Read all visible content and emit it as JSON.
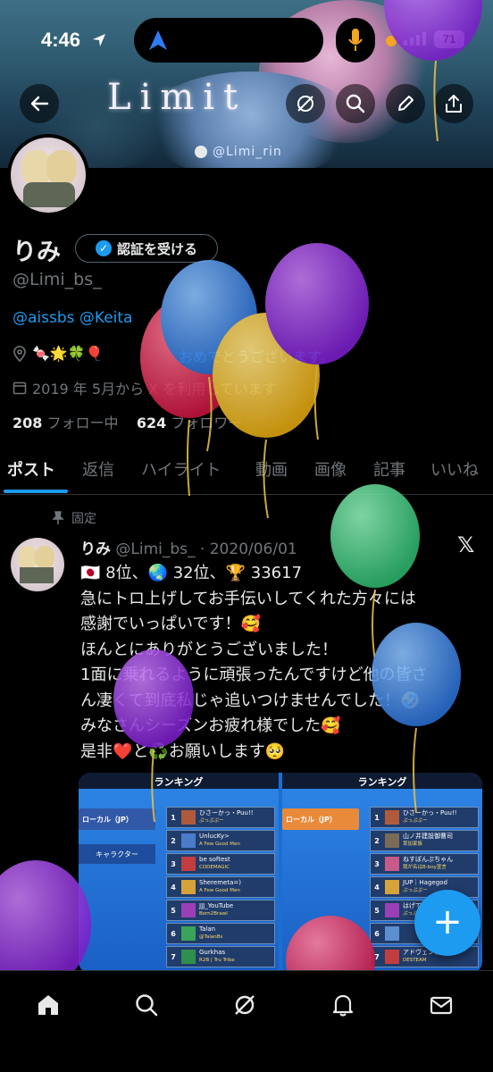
{
  "status_bar": {
    "time": "4:46",
    "battery": "71"
  },
  "banner": {
    "title": "Limit",
    "handle": "@Limi_rin"
  },
  "profile": {
    "name": "りみ",
    "verify_button": "認証を受ける",
    "handle": "@Limi_bs_",
    "bio": "@aissbs @Keita",
    "location": "🍬🌟🍀🎈",
    "birthday_text": "おめでとうございます。",
    "joined": "2019 年 5月から X を利用しています",
    "following_count": "208",
    "following_label": "フォロー中",
    "followers_count": "624",
    "followers_label": "フォロワー"
  },
  "tabs": [
    "ポスト",
    "返信",
    "ハイライト",
    "動画",
    "画像",
    "記事",
    "いいね"
  ],
  "post": {
    "pinned_label": "固定",
    "author": "りみ",
    "meta": "@Limi_bs_ · 2020/06/01",
    "lines": [
      "🇯🇵 8位、🌏 32位、🏆 33617",
      "急にトロ上げしてお手伝いしてくれた方々には",
      "感謝でいっぱいです！🥰",
      "ほんとにありがとうございました！",
      "1面に乗れるように頑張ったんですけど他の皆さ",
      "ん凄くて到底私じゃ追いつけませんでした！🤣",
      "みなさんシーズンお疲れ様でした🥰",
      "是非❤️と♻️お願いします🥺"
    ],
    "media": {
      "left": {
        "title": "ランキング",
        "local_label": "ローカル（JP）",
        "character_label": "キャラクター",
        "rows": [
          {
            "rank": "1",
            "name": "ひさーかっ・Puu!!",
            "sub": "ぷっぷぷー"
          },
          {
            "rank": "2",
            "name": "UnlucKy>",
            "sub": "A Few Good Men"
          },
          {
            "rank": "3",
            "name": "be softest",
            "sub": "CODEMAGIC"
          },
          {
            "rank": "4",
            "name": "Sheremeta=)",
            "sub": "A Few Good Men"
          },
          {
            "rank": "5",
            "name": "JJJ_YouTube",
            "sub": "Born2Brawl"
          },
          {
            "rank": "6",
            "name": "Talan",
            "sub": "@TalanBs"
          },
          {
            "rank": "7",
            "name": "Gurkhas",
            "sub": "R2B | Tru Tribe"
          }
        ]
      },
      "right": {
        "title": "ランキング",
        "local_label": "ローカル（JP）",
        "rows": [
          {
            "rank": "1",
            "name": "ひさーかっ・Puu!!",
            "sub": "ぷっぷぷー"
          },
          {
            "rank": "2",
            "name": "山ノ井建設御曹司",
            "sub": "草加家族"
          },
          {
            "rank": "3",
            "name": "ねすぽんぷちゃん",
            "sub": "我が名はB-boy宣言"
          },
          {
            "rank": "4",
            "name": "JUP｜Hagegod",
            "sub": "ぷっぷぷー"
          },
          {
            "rank": "5",
            "name": "はげてるヨ⭐️まりちゃん",
            "sub": "ぷっぷぷー"
          },
          {
            "rank": "6",
            "name": "",
            "sub": ""
          },
          {
            "rank": "7",
            "name": "アドヴェンティン",
            "sub": "DESTEAM"
          }
        ]
      }
    }
  },
  "fab_label": "+",
  "icons": {
    "back": "back-arrow-icon",
    "grok": "grok-icon",
    "search": "search-icon",
    "compose": "pen-icon",
    "share": "share-icon",
    "home": "home-icon",
    "notifications": "bell-icon",
    "messages": "mail-icon",
    "location": "location-pin-icon",
    "calendar": "calendar-icon"
  },
  "colors": {
    "accent": "#1d9bf0",
    "background": "#000000",
    "muted": "#71767b"
  }
}
